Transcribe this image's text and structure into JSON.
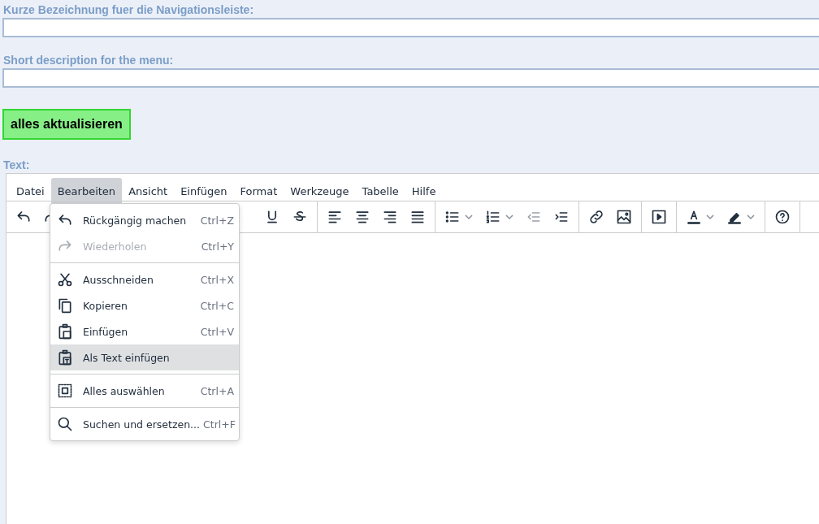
{
  "fields": [
    {
      "label": "Kurze Bezeichnung fuer die Navigationsleiste:"
    },
    {
      "label": "Short description for the menu:"
    }
  ],
  "update_button": "alles aktualisieren",
  "editor": {
    "label": "Text:",
    "menubar": [
      {
        "label": "Datei",
        "selected": false
      },
      {
        "label": "Bearbeiten",
        "selected": true
      },
      {
        "label": "Ansicht",
        "selected": false
      },
      {
        "label": "Einfügen",
        "selected": false
      },
      {
        "label": "Format",
        "selected": false
      },
      {
        "label": "Werkzeuge",
        "selected": false
      },
      {
        "label": "Tabelle",
        "selected": false
      },
      {
        "label": "Hilfe",
        "selected": false
      }
    ],
    "toolbar": [
      [
        {
          "disabled": false,
          "split": false
        },
        {
          "disabled": false,
          "split": false
        }
      ],
      [
        {
          "disabled": false,
          "split": false
        },
        {
          "disabled": false,
          "split": false
        }
      ],
      [
        {
          "disabled": false,
          "split": false
        },
        {
          "disabled": false,
          "split": false
        },
        {
          "disabled": false,
          "split": false
        },
        {
          "disabled": false,
          "split": false
        }
      ],
      [
        {
          "disabled": false,
          "split": true
        },
        {
          "disabled": false,
          "split": true
        },
        {
          "disabled": true,
          "split": false
        },
        {
          "disabled": false,
          "split": false
        }
      ],
      [
        {
          "disabled": false,
          "split": false
        },
        {
          "disabled": false,
          "split": false
        }
      ],
      [
        {
          "disabled": false,
          "split": false
        }
      ],
      [
        {
          "disabled": false,
          "split": true
        },
        {
          "disabled": false,
          "split": true
        }
      ],
      [
        {
          "disabled": false,
          "split": false
        }
      ]
    ],
    "menu": [
      [
        {
          "label": "Rückgängig machen",
          "shortcut": "Ctrl+Z",
          "disabled": false,
          "selected": false
        },
        {
          "label": "Wiederholen",
          "shortcut": "Ctrl+Y",
          "disabled": true,
          "selected": false
        }
      ],
      [
        {
          "label": "Ausschneiden",
          "shortcut": "Ctrl+X",
          "disabled": false,
          "selected": false
        },
        {
          "label": "Kopieren",
          "shortcut": "Ctrl+C",
          "disabled": false,
          "selected": false
        },
        {
          "label": "Einfügen",
          "shortcut": "Ctrl+V",
          "disabled": false,
          "selected": false
        },
        {
          "label": "Als Text einfügen",
          "disabled": false,
          "selected": true
        }
      ],
      [
        {
          "label": "Alles auswählen",
          "shortcut": "Ctrl+A",
          "disabled": false,
          "selected": false
        }
      ],
      [
        {
          "label": "Suchen und ersetzen...",
          "shortcut": "Ctrl+F",
          "disabled": false,
          "selected": false
        }
      ]
    ]
  }
}
